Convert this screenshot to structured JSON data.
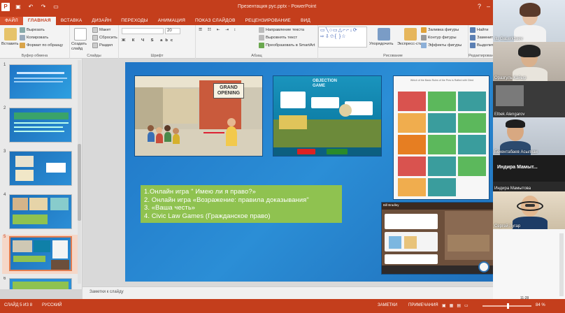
{
  "window": {
    "title": "Презентация рус.pptx - PowerPoint",
    "file_tab": "ФАЙЛ"
  },
  "tabs": [
    "ГЛАВНАЯ",
    "ВСТАВКА",
    "ДИЗАЙН",
    "ПЕРЕХОДЫ",
    "АНИМАЦИЯ",
    "ПОКАЗ СЛАЙДОВ",
    "РЕЦЕНЗИРОВАНИЕ",
    "ВИД"
  ],
  "ribbon": {
    "clipboard": {
      "label": "Буфер обмена",
      "paste": "Вставить",
      "cut": "Вырезать",
      "copy": "Копировать",
      "format_painter": "Формат по образцу"
    },
    "slides": {
      "label": "Слайды",
      "new_slide": "Создать слайд",
      "layout": "Макет",
      "reset": "Сбросить",
      "section": "Раздел"
    },
    "font": {
      "label": "Шрифт",
      "size": "20"
    },
    "paragraph": {
      "label": "Абзац",
      "text_direction": "Направление текста",
      "align_text": "Выровнять текст",
      "smartart": "Преобразовать в SmartArt"
    },
    "drawing": {
      "label": "Рисование",
      "arrange": "Упорядочить",
      "quick_styles": "Экспресс-стили",
      "fill": "Заливка фигуры",
      "outline": "Контур фигуры",
      "effects": "Эффекты фигуры"
    },
    "editing": {
      "label": "Редактирование",
      "find": "Найти",
      "replace": "Заменить",
      "select": "Выделить"
    }
  },
  "slides_panel": {
    "numbers": [
      "1",
      "2",
      "3",
      "4",
      "5",
      "6"
    ],
    "selected": "5"
  },
  "slide": {
    "list": [
      "1.Онлайн игра \" Имею ли я право?»",
      "2. Онлайн игра «Возражение: правила доказывания\"",
      "3. «Ваша честь»",
      "4. Civic Law Games (Гражданское право)"
    ],
    "img1_sign": "GRAND\nOPENING",
    "img2_title": "OBJECTION GAME",
    "img3_title": "Which of the Basic Rules of the Pres is Rafted with Cited",
    "img4_label": "Bill Bradley"
  },
  "notes_placeholder": "Заметки к слайду",
  "participants": [
    {
      "name": "itu GaLerkbaev"
    },
    {
      "name": "Оразгуль Кайыр"
    },
    {
      "name": "Elbek Alengarov"
    },
    {
      "name": "Бекентабаев Асылхан"
    },
    {
      "name": "Индира Мамыт..."
    },
    {
      "name": "Индира Мамытова"
    },
    {
      "name": "Сергей Лугар"
    }
  ],
  "status": {
    "slide_info": "СЛАЙД 5 ИЗ 8",
    "language": "РУССКИЙ",
    "notes": "ЗАМЕТКИ",
    "comments": "ПРИМЕЧАНИЯ",
    "zoom": "84 %",
    "time": "11:28"
  },
  "colors": {
    "accent": "#c43e1c",
    "slide_bg": "#2b8ed6",
    "textbox_bg": "#8fc250"
  }
}
